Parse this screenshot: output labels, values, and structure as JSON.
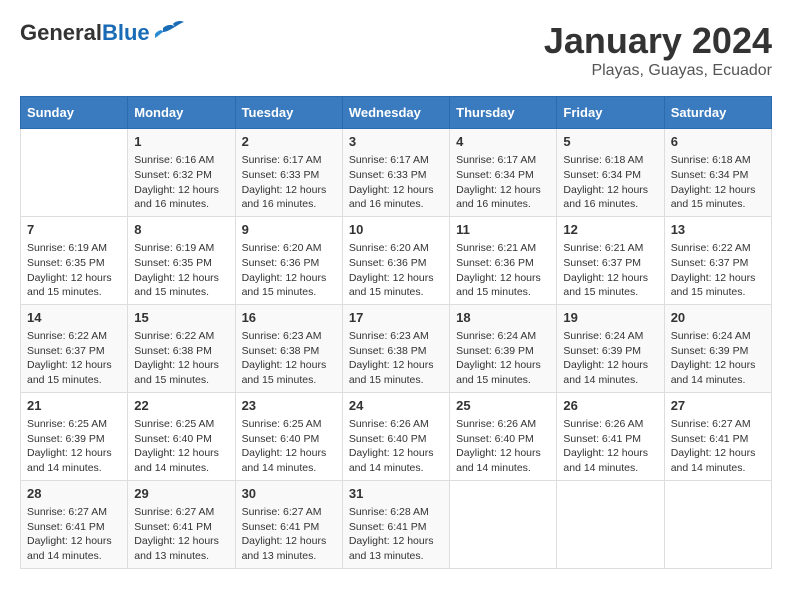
{
  "header": {
    "logo_general": "General",
    "logo_blue": "Blue",
    "title": "January 2024",
    "subtitle": "Playas, Guayas, Ecuador"
  },
  "weekdays": [
    "Sunday",
    "Monday",
    "Tuesday",
    "Wednesday",
    "Thursday",
    "Friday",
    "Saturday"
  ],
  "weeks": [
    [
      {
        "num": "",
        "info": ""
      },
      {
        "num": "1",
        "info": "Sunrise: 6:16 AM\nSunset: 6:32 PM\nDaylight: 12 hours\nand 16 minutes."
      },
      {
        "num": "2",
        "info": "Sunrise: 6:17 AM\nSunset: 6:33 PM\nDaylight: 12 hours\nand 16 minutes."
      },
      {
        "num": "3",
        "info": "Sunrise: 6:17 AM\nSunset: 6:33 PM\nDaylight: 12 hours\nand 16 minutes."
      },
      {
        "num": "4",
        "info": "Sunrise: 6:17 AM\nSunset: 6:34 PM\nDaylight: 12 hours\nand 16 minutes."
      },
      {
        "num": "5",
        "info": "Sunrise: 6:18 AM\nSunset: 6:34 PM\nDaylight: 12 hours\nand 16 minutes."
      },
      {
        "num": "6",
        "info": "Sunrise: 6:18 AM\nSunset: 6:34 PM\nDaylight: 12 hours\nand 15 minutes."
      }
    ],
    [
      {
        "num": "7",
        "info": "Sunrise: 6:19 AM\nSunset: 6:35 PM\nDaylight: 12 hours\nand 15 minutes."
      },
      {
        "num": "8",
        "info": "Sunrise: 6:19 AM\nSunset: 6:35 PM\nDaylight: 12 hours\nand 15 minutes."
      },
      {
        "num": "9",
        "info": "Sunrise: 6:20 AM\nSunset: 6:36 PM\nDaylight: 12 hours\nand 15 minutes."
      },
      {
        "num": "10",
        "info": "Sunrise: 6:20 AM\nSunset: 6:36 PM\nDaylight: 12 hours\nand 15 minutes."
      },
      {
        "num": "11",
        "info": "Sunrise: 6:21 AM\nSunset: 6:36 PM\nDaylight: 12 hours\nand 15 minutes."
      },
      {
        "num": "12",
        "info": "Sunrise: 6:21 AM\nSunset: 6:37 PM\nDaylight: 12 hours\nand 15 minutes."
      },
      {
        "num": "13",
        "info": "Sunrise: 6:22 AM\nSunset: 6:37 PM\nDaylight: 12 hours\nand 15 minutes."
      }
    ],
    [
      {
        "num": "14",
        "info": "Sunrise: 6:22 AM\nSunset: 6:37 PM\nDaylight: 12 hours\nand 15 minutes."
      },
      {
        "num": "15",
        "info": "Sunrise: 6:22 AM\nSunset: 6:38 PM\nDaylight: 12 hours\nand 15 minutes."
      },
      {
        "num": "16",
        "info": "Sunrise: 6:23 AM\nSunset: 6:38 PM\nDaylight: 12 hours\nand 15 minutes."
      },
      {
        "num": "17",
        "info": "Sunrise: 6:23 AM\nSunset: 6:38 PM\nDaylight: 12 hours\nand 15 minutes."
      },
      {
        "num": "18",
        "info": "Sunrise: 6:24 AM\nSunset: 6:39 PM\nDaylight: 12 hours\nand 15 minutes."
      },
      {
        "num": "19",
        "info": "Sunrise: 6:24 AM\nSunset: 6:39 PM\nDaylight: 12 hours\nand 14 minutes."
      },
      {
        "num": "20",
        "info": "Sunrise: 6:24 AM\nSunset: 6:39 PM\nDaylight: 12 hours\nand 14 minutes."
      }
    ],
    [
      {
        "num": "21",
        "info": "Sunrise: 6:25 AM\nSunset: 6:39 PM\nDaylight: 12 hours\nand 14 minutes."
      },
      {
        "num": "22",
        "info": "Sunrise: 6:25 AM\nSunset: 6:40 PM\nDaylight: 12 hours\nand 14 minutes."
      },
      {
        "num": "23",
        "info": "Sunrise: 6:25 AM\nSunset: 6:40 PM\nDaylight: 12 hours\nand 14 minutes."
      },
      {
        "num": "24",
        "info": "Sunrise: 6:26 AM\nSunset: 6:40 PM\nDaylight: 12 hours\nand 14 minutes."
      },
      {
        "num": "25",
        "info": "Sunrise: 6:26 AM\nSunset: 6:40 PM\nDaylight: 12 hours\nand 14 minutes."
      },
      {
        "num": "26",
        "info": "Sunrise: 6:26 AM\nSunset: 6:41 PM\nDaylight: 12 hours\nand 14 minutes."
      },
      {
        "num": "27",
        "info": "Sunrise: 6:27 AM\nSunset: 6:41 PM\nDaylight: 12 hours\nand 14 minutes."
      }
    ],
    [
      {
        "num": "28",
        "info": "Sunrise: 6:27 AM\nSunset: 6:41 PM\nDaylight: 12 hours\nand 14 minutes."
      },
      {
        "num": "29",
        "info": "Sunrise: 6:27 AM\nSunset: 6:41 PM\nDaylight: 12 hours\nand 13 minutes."
      },
      {
        "num": "30",
        "info": "Sunrise: 6:27 AM\nSunset: 6:41 PM\nDaylight: 12 hours\nand 13 minutes."
      },
      {
        "num": "31",
        "info": "Sunrise: 6:28 AM\nSunset: 6:41 PM\nDaylight: 12 hours\nand 13 minutes."
      },
      {
        "num": "",
        "info": ""
      },
      {
        "num": "",
        "info": ""
      },
      {
        "num": "",
        "info": ""
      }
    ]
  ]
}
